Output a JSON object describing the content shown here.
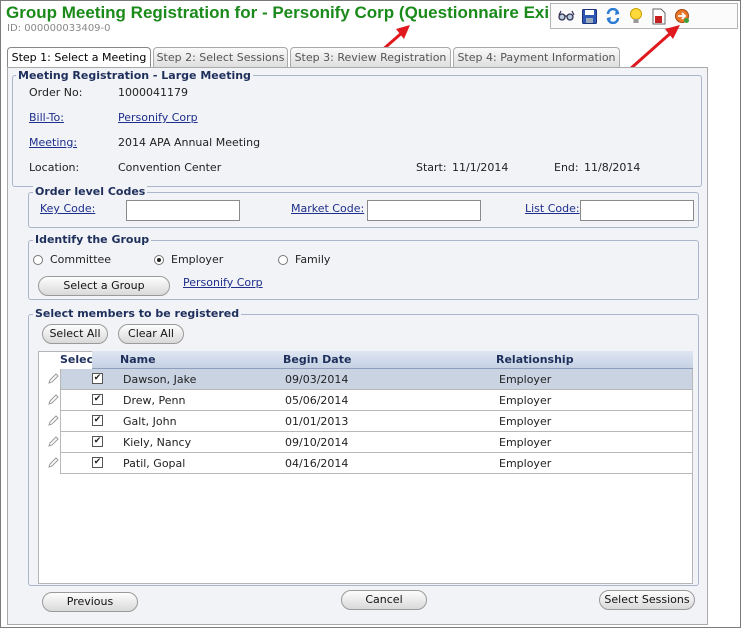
{
  "header": {
    "title": "Group Meeting Registration for - Personify Corp (Questionnaire Exists)",
    "id_text": "ID: 000000033409-0"
  },
  "toolbar": {
    "icons": [
      "glasses-icon",
      "save-icon",
      "refresh-icon",
      "lightbulb-icon",
      "document-icon",
      "exit-icon"
    ]
  },
  "tabs": [
    {
      "label": "Step 1: Select a Meeting",
      "active": true
    },
    {
      "label": "Step 2: Select Sessions",
      "active": false
    },
    {
      "label": "Step 3: Review Registration",
      "active": false
    },
    {
      "label": "Step 4: Payment Information",
      "active": false
    }
  ],
  "meeting_section": {
    "legend": "Meeting Registration - Large Meeting",
    "order_label": "Order No:",
    "order_value": "1000041179",
    "billto_label": "Bill-To:",
    "billto_value": "Personify Corp",
    "meeting_label": "Meeting:",
    "meeting_value": "2014 APA Annual Meeting",
    "location_label": "Location:",
    "location_value": "Convention Center",
    "start_label": "Start:",
    "start_value": "11/1/2014",
    "end_label": "End:",
    "end_value": "11/8/2014"
  },
  "codes_section": {
    "legend": "Order level Codes",
    "key_code_label": "Key Code:",
    "key_code_value": "",
    "market_code_label": "Market Code:",
    "market_code_value": "",
    "list_code_label": "List Code:",
    "list_code_value": ""
  },
  "group_section": {
    "legend": "Identify the Group",
    "options": [
      {
        "label": "Committee",
        "checked": false
      },
      {
        "label": "Employer",
        "checked": true
      },
      {
        "label": "Family",
        "checked": false
      }
    ],
    "select_group_label": "Select a Group",
    "group_link": "Personify Corp"
  },
  "members_section": {
    "legend": "Select members to be registered",
    "select_all_label": "Select All",
    "clear_all_label": "Clear All",
    "columns": {
      "select": "Select",
      "name": "Name",
      "begin": "Begin Date",
      "relationship": "Relationship"
    },
    "rows": [
      {
        "name": "Dawson, Jake",
        "begin": "09/03/2014",
        "relationship": "Employer",
        "checked": true,
        "selected": true
      },
      {
        "name": "Drew, Penn",
        "begin": "05/06/2014",
        "relationship": "Employer",
        "checked": true,
        "selected": false
      },
      {
        "name": "Galt, John",
        "begin": "01/01/2013",
        "relationship": "Employer",
        "checked": true,
        "selected": false
      },
      {
        "name": "Kiely, Nancy",
        "begin": "09/10/2014",
        "relationship": "Employer",
        "checked": true,
        "selected": false
      },
      {
        "name": "Patil, Gopal",
        "begin": "04/16/2014",
        "relationship": "Employer",
        "checked": true,
        "selected": false
      }
    ]
  },
  "footer": {
    "previous_label": "Previous",
    "cancel_label": "Cancel",
    "select_sessions_label": "Select Sessions"
  },
  "colors": {
    "title": "#1a8a1a",
    "arrow": "#e0191e",
    "legend": "#1f2f5c",
    "link": "#1d2e8c"
  }
}
